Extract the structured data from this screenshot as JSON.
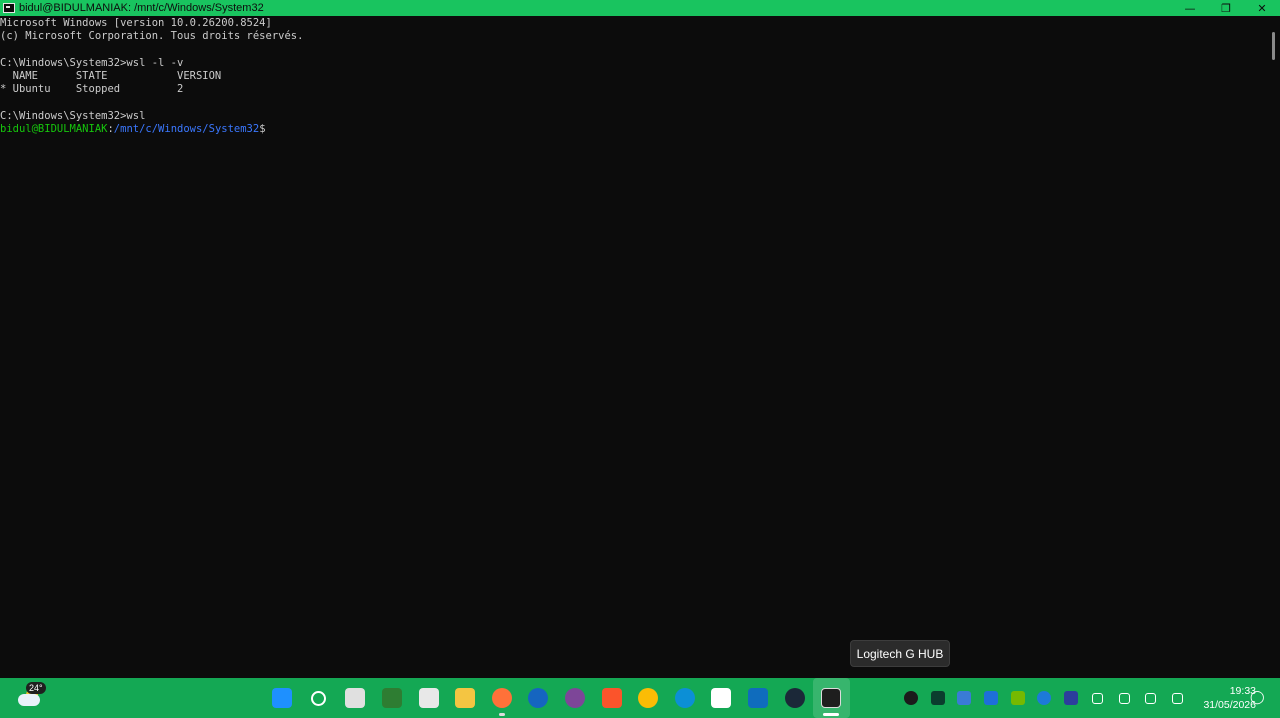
{
  "window": {
    "title": "bidul@BIDULMANIAK: /mnt/c/Windows/System32",
    "controls": {
      "minimize": "—",
      "maximize": "❐",
      "close": "✕"
    }
  },
  "terminal": {
    "lines": [
      "Microsoft Windows [version 10.0.26200.8524]",
      "(c) Microsoft Corporation. Tous droits réservés.",
      "",
      "C:\\Windows\\System32>wsl -l -v",
      "  NAME      STATE           VERSION",
      "* Ubuntu    Stopped         2",
      "",
      "C:\\Windows\\System32>wsl"
    ],
    "prompt": {
      "user_host": "bidul@BIDULMANIAK",
      "sep": ":",
      "path": "/mnt/c/Windows/System32",
      "symbol": "$"
    }
  },
  "tooltip": {
    "text": "Logitech G HUB"
  },
  "taskbar": {
    "weather": {
      "temperature": "24°"
    },
    "apps": [
      {
        "name": "start-icon",
        "color": "#1e90ff"
      },
      {
        "name": "search-icon",
        "color": "#ffffff"
      },
      {
        "name": "task-view-icon",
        "color": "#e0e0e0"
      },
      {
        "name": "app-green-icon",
        "color": "#2e7d32"
      },
      {
        "name": "printer-icon",
        "color": "#e8e8e8"
      },
      {
        "name": "file-explorer-icon",
        "color": "#f4c542"
      },
      {
        "name": "firefox-icon",
        "color": "#ff7139"
      },
      {
        "name": "app-blue-icon",
        "color": "#1565c0"
      },
      {
        "name": "tor-browser-icon",
        "color": "#7d4698"
      },
      {
        "name": "brave-icon",
        "color": "#fb542b"
      },
      {
        "name": "chrome-icon",
        "color": "#fbbc05"
      },
      {
        "name": "edge-icon",
        "color": "#0c8fd6"
      },
      {
        "name": "microsoft-store-icon",
        "color": "#ffffff"
      },
      {
        "name": "mail-icon",
        "color": "#0f6cbd"
      },
      {
        "name": "steam-icon",
        "color": "#1b2838"
      },
      {
        "name": "terminal-icon",
        "color": "#1e1e1e"
      }
    ],
    "tray": [
      {
        "name": "logitech-g-hub-icon",
        "color": "#1b1b1b"
      },
      {
        "name": "tray-app-icon",
        "color": "#0b3d2e"
      },
      {
        "name": "defender-icon",
        "color": "#3a7bd5"
      },
      {
        "name": "malwarebytes-icon",
        "color": "#1e6fd9"
      },
      {
        "name": "nvidia-icon",
        "color": "#76b900"
      },
      {
        "name": "tray-circle-icon",
        "color": "#1d7ad8"
      },
      {
        "name": "d-app-icon",
        "color": "#2c3e9c"
      },
      {
        "name": "bluetooth-icon",
        "color": "#ffffff"
      },
      {
        "name": "keyboard-icon",
        "color": "#ffffff"
      },
      {
        "name": "network-icon",
        "color": "#ffffff"
      },
      {
        "name": "volume-icon",
        "color": "#ffffff"
      }
    ],
    "clock": {
      "time": "19:33",
      "date": "31/05/2026"
    }
  }
}
